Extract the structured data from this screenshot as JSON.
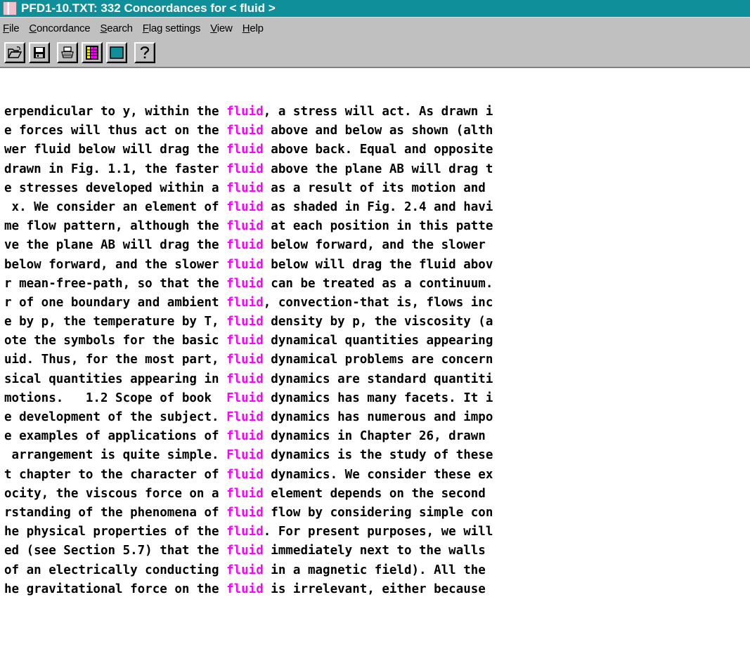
{
  "window": {
    "title": "PFD1-10.TXT: 332 Concordances for < fluid >"
  },
  "menu": [
    {
      "pre": "",
      "u": "F",
      "post": "ile"
    },
    {
      "pre": "",
      "u": "C",
      "post": "oncordance"
    },
    {
      "pre": "",
      "u": "S",
      "post": "earch"
    },
    {
      "pre": "",
      "u": "F",
      "post": "lag settings"
    },
    {
      "pre": "",
      "u": "V",
      "post": "iew"
    },
    {
      "pre": "",
      "u": "H",
      "post": "elp"
    }
  ],
  "toolbar": {
    "buttons": [
      {
        "icon": "open-folder-icon"
      },
      {
        "icon": "save-disk-icon"
      },
      {
        "icon": "printer-icon"
      },
      {
        "icon": "color-palette-icon"
      },
      {
        "icon": "blank-panel-icon"
      },
      {
        "icon": "help-question-icon"
      }
    ]
  },
  "colors": {
    "keyword": "#ff00ff",
    "titlebar": "#0f8f9a",
    "chrome": "#c0c0c0"
  },
  "concordance": {
    "lines": [
      {
        "left": "erpendicular to y, within the ",
        "kw": "fluid",
        "right": ", a stress will act. As drawn i"
      },
      {
        "left": "e forces will thus act on the ",
        "kw": "fluid",
        "right": " above and below as shown (alth"
      },
      {
        "left": "wer fluid below will drag the ",
        "kw": "fluid",
        "right": " above back. Equal and opposite"
      },
      {
        "left": "drawn in Fig. 1.1, the faster ",
        "kw": "fluid",
        "right": " above the plane AB will drag t"
      },
      {
        "left": "e stresses developed within a ",
        "kw": "fluid",
        "right": " as a result of its motion and"
      },
      {
        "left": " x. We consider an element of ",
        "kw": "fluid",
        "right": " as shaded in Fig. 2.4 and havi"
      },
      {
        "left": "me flow pattern, although the ",
        "kw": "fluid",
        "right": " at each position in this patte"
      },
      {
        "left": "ve the plane AB will drag the ",
        "kw": "fluid",
        "right": " below forward, and the slower"
      },
      {
        "left": "below forward, and the slower ",
        "kw": "fluid",
        "right": " below will drag the fluid abov"
      },
      {
        "left": "r mean-free-path, so that the ",
        "kw": "fluid",
        "right": " can be treated as a continuum."
      },
      {
        "left": "r of one boundary and ambient ",
        "kw": "fluid",
        "right": ", convection-that is, flows inc"
      },
      {
        "left": "e by p, the temperature by T, ",
        "kw": "fluid",
        "right": " density by p, the viscosity (a"
      },
      {
        "left": "ote the symbols for the basic ",
        "kw": "fluid",
        "right": " dynamical quantities appearing"
      },
      {
        "left": "uid. Thus, for the most part, ",
        "kw": "fluid",
        "right": " dynamical problems are concern"
      },
      {
        "left": "sical quantities appearing in ",
        "kw": "fluid",
        "right": " dynamics are standard quantiti"
      },
      {
        "left": "motions.   1.2 Scope of book  ",
        "kw": "Fluid",
        "right": " dynamics has many facets. It i"
      },
      {
        "left": "e development of the subject. ",
        "kw": "Fluid",
        "right": " dynamics has numerous and impo"
      },
      {
        "left": "e examples of applications of ",
        "kw": "fluid",
        "right": " dynamics in Chapter 26, drawn"
      },
      {
        "left": " arrangement is quite simple. ",
        "kw": "Fluid",
        "right": " dynamics is the study of these"
      },
      {
        "left": "t chapter to the character of ",
        "kw": "fluid",
        "right": " dynamics. We consider these ex"
      },
      {
        "left": "ocity, the viscous force on a ",
        "kw": "fluid",
        "right": " element depends on the second"
      },
      {
        "left": "rstanding of the phenomena of ",
        "kw": "fluid",
        "right": " flow by considering simple con"
      },
      {
        "left": "he physical properties of the ",
        "kw": "fluid",
        "right": ". For present purposes, we will"
      },
      {
        "left": "ed (see Section 5.7) that the ",
        "kw": "fluid",
        "right": " immediately next to the walls"
      },
      {
        "left": "of an electrically conducting ",
        "kw": "fluid",
        "right": " in a magnetic field). All the"
      },
      {
        "left": "he gravitational force on the ",
        "kw": "fluid",
        "right": " is irrelevant, either because"
      }
    ]
  }
}
